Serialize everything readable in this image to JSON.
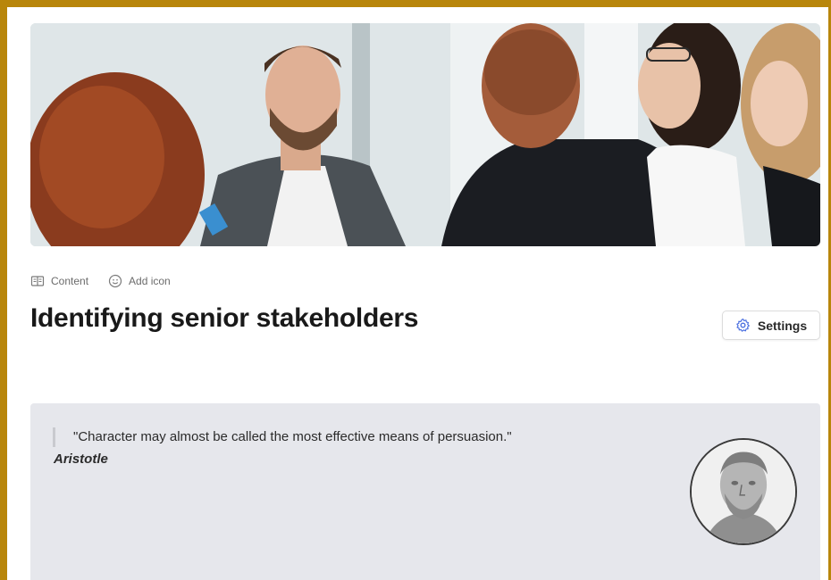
{
  "toolbar": {
    "content_label": "Content",
    "add_icon_label": "Add icon"
  },
  "page": {
    "title": "Identifying senior stakeholders"
  },
  "settings": {
    "label": "Settings"
  },
  "quote": {
    "text": "\"Character may almost be called the most effective means of persuasion.\"",
    "author": "Aristotle"
  },
  "icons": {
    "content": "book-icon",
    "add_icon": "smiley-icon",
    "settings": "gear-icon"
  },
  "colors": {
    "frame": "#b8860b",
    "quote_panel": "#e6e7ec",
    "settings_icon": "#4a6fe0",
    "title_text": "#191919"
  }
}
